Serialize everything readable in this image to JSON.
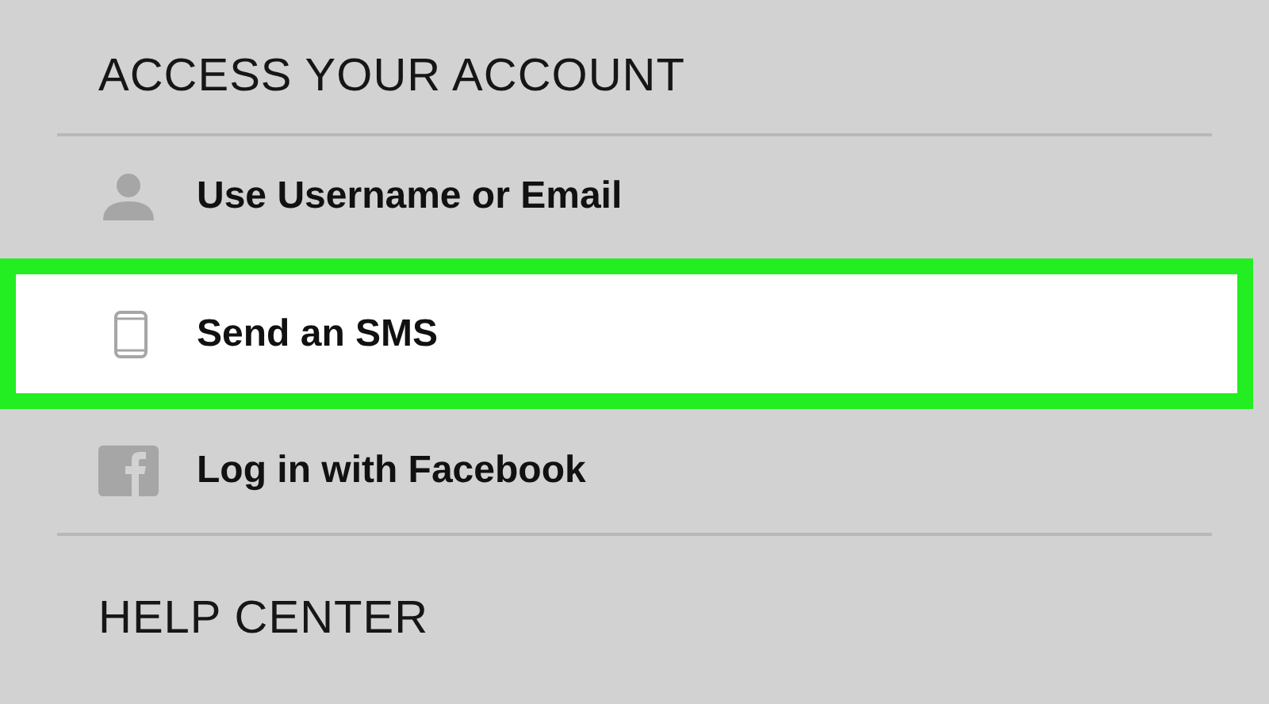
{
  "sections": [
    {
      "heading": "ACCESS YOUR ACCOUNT",
      "items": [
        {
          "kind": "person",
          "label": "Use Username or Email",
          "selected": false
        },
        {
          "kind": "phone",
          "label": "Send an SMS",
          "selected": true
        },
        {
          "kind": "facebook",
          "label": "Log in with Facebook",
          "selected": false
        }
      ]
    },
    {
      "heading": "HELP CENTER"
    }
  ]
}
